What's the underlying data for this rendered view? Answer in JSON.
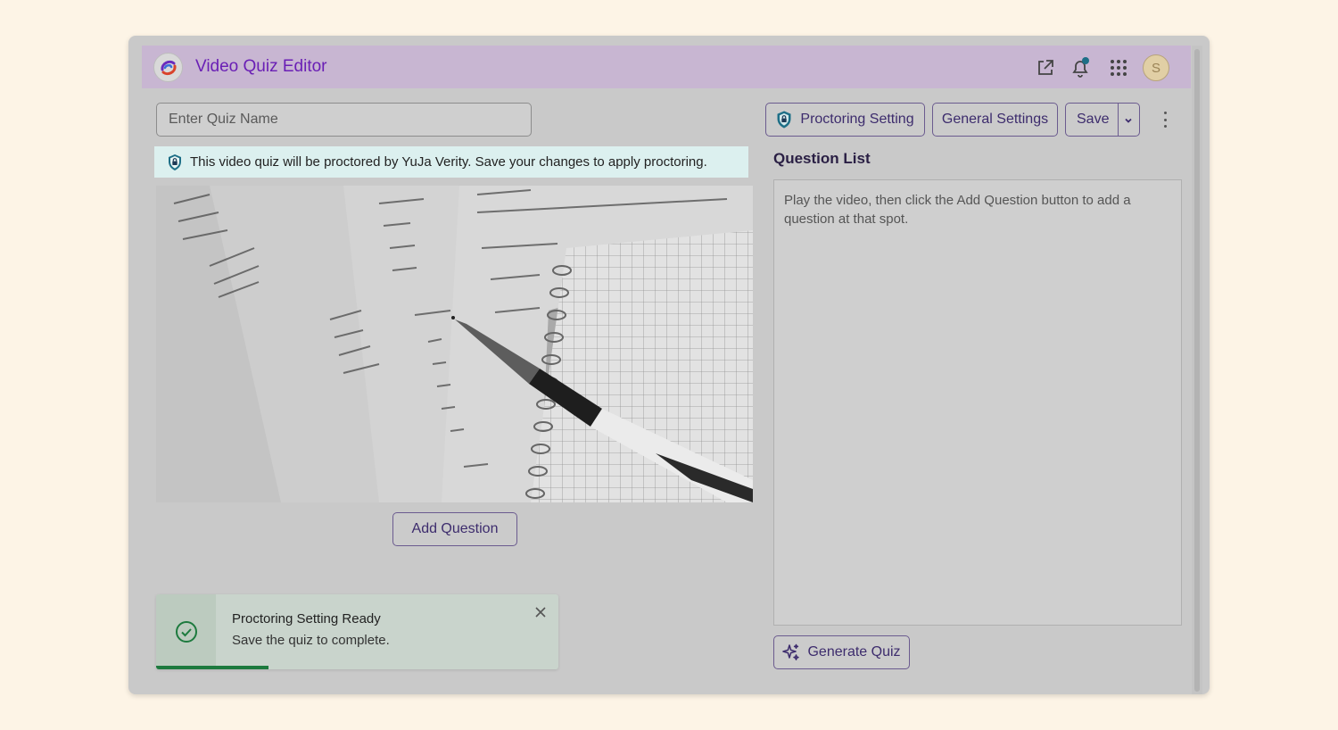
{
  "header": {
    "title": "Video Quiz Editor",
    "avatar_initial": "S",
    "icons": [
      "open-external-icon",
      "bell-icon",
      "apps-grid-icon"
    ]
  },
  "quiz": {
    "name_placeholder": "Enter Quiz Name",
    "name_value": ""
  },
  "toolbar": {
    "proctoring_label": "Proctoring Setting",
    "general_label": "General Settings",
    "save_label": "Save"
  },
  "notice": {
    "text": "This video quiz will be proctored by YuJa Verity. Save your changes to apply proctoring."
  },
  "video": {
    "add_question_label": "Add Question"
  },
  "question_list": {
    "title": "Question List",
    "empty_text": "Play the video, then click the Add Question button to add a question at that spot.",
    "generate_label": "Generate Quiz"
  },
  "toast": {
    "title": "Proctoring Setting Ready",
    "body": "Save the quiz to complete.",
    "progress_fraction": 0.28
  },
  "colors": {
    "accent": "#6a1fb5",
    "header_bg": "#c8b6d2",
    "notice_bg": "#dcf0ef",
    "success": "#1d7a3e"
  }
}
